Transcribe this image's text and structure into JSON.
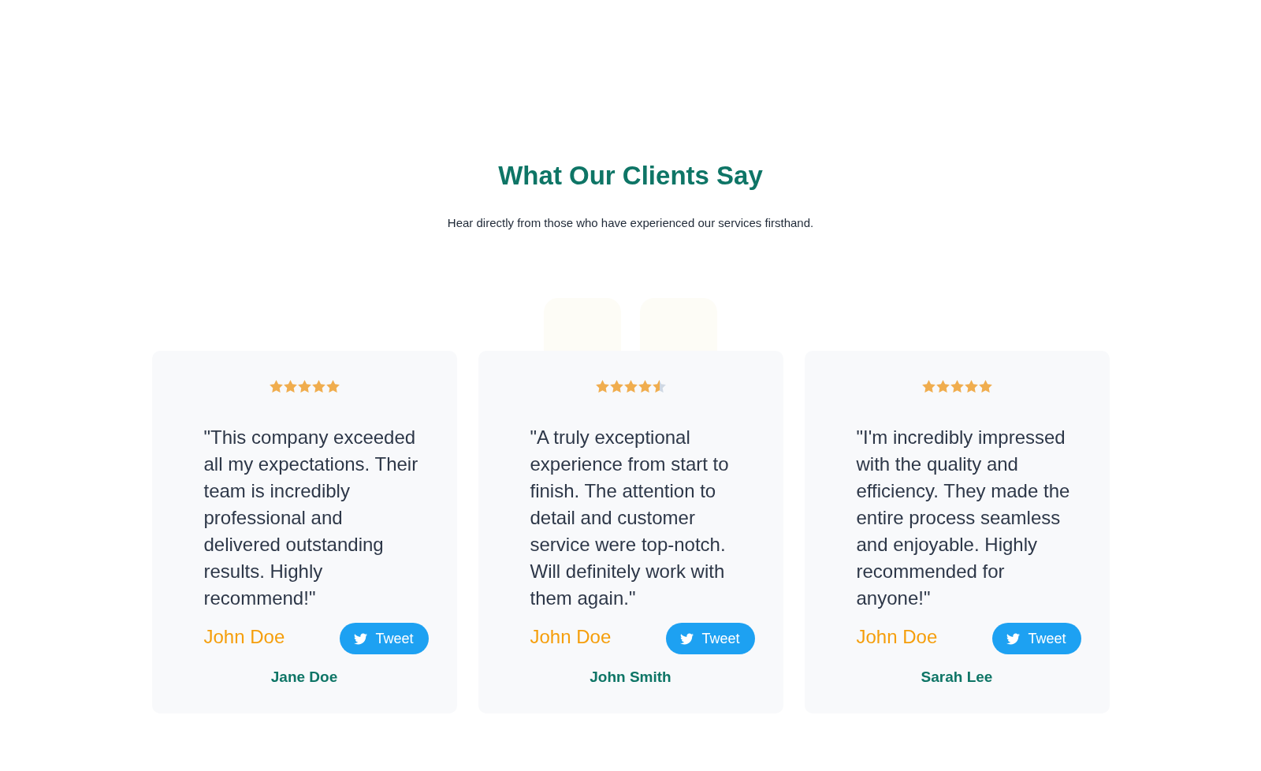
{
  "header": {
    "title": "What Our Clients Say",
    "subtitle": "Hear directly from those who have experienced our services firsthand."
  },
  "testimonials": [
    {
      "stars": 5,
      "quote": "\"This company exceeded all my expectations. Their team is incredibly professional and delivered outstanding results. Highly recommend!\"",
      "name": "John Doe",
      "button": "Tweet",
      "client": "Jane Doe"
    },
    {
      "stars": 4.5,
      "quote": "\"A truly exceptional experience from start to finish. The attention to detail and customer service were top-notch. Will definitely work with them again.\"",
      "name": "John Doe",
      "button": "Tweet",
      "client": "John Smith"
    },
    {
      "stars": 5,
      "quote": "\"I'm incredibly impressed with the quality and efficiency. They made the entire process seamless and enjoyable. Highly recommended for anyone!\"",
      "name": "John Doe",
      "button": "Tweet",
      "client": "Sarah Lee"
    }
  ]
}
